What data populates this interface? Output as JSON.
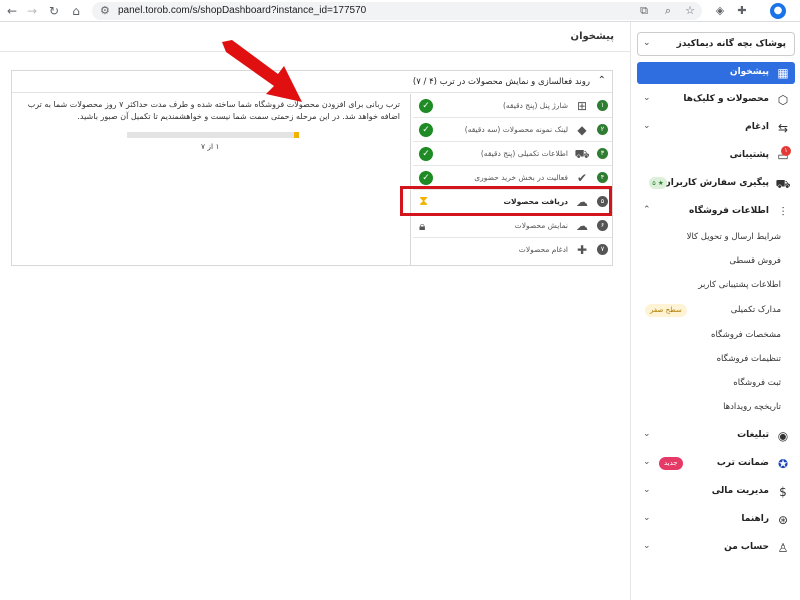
{
  "browser": {
    "url": "panel.torob.com/s/shopDashboard?instance_id=177570"
  },
  "header": {
    "title": "پیشخوان"
  },
  "sidebar": {
    "shop_name": "پوشاک بچه گانه دیماکیدز",
    "items": [
      {
        "label": "پیشخوان",
        "icon": "dashboard-icon",
        "active": true
      },
      {
        "label": "محصولات و کلیک‌ها",
        "icon": "box-icon"
      },
      {
        "label": "ادغام",
        "icon": "merge-icon"
      },
      {
        "label": "پشتیبانی",
        "icon": "chat-icon",
        "badge": "۱"
      },
      {
        "label": "پیگیری سفارش کاربران",
        "icon": "truck-icon",
        "badge": "۵ ★"
      },
      {
        "label": "اطلاعات فروشگاه",
        "icon": "sliders-icon"
      }
    ],
    "sub_items": [
      {
        "label": "شرایط ارسال و تحویل کالا"
      },
      {
        "label": "فروش قسطی"
      },
      {
        "label": "اطلاعات پشتیبانی کاربر"
      },
      {
        "label": "مدارک تکمیلی",
        "badge": "سطح صفر"
      },
      {
        "label": "مشخصات فروشگاه"
      },
      {
        "label": "تنظیمات فروشگاه"
      },
      {
        "label": "ثبت فروشگاه"
      },
      {
        "label": "تاریخچه رویدادها"
      }
    ],
    "bottom_items": [
      {
        "label": "تبلیغات",
        "icon": "broadcast-icon"
      },
      {
        "label": "ضمانت ترب",
        "icon": "shield-icon",
        "badge": "جدید"
      },
      {
        "label": "مدیریت مالی",
        "icon": "dollar-icon"
      },
      {
        "label": "راهنما",
        "icon": "help-icon"
      },
      {
        "label": "حساب من",
        "icon": "user-icon"
      }
    ]
  },
  "panel": {
    "title": "روند فعالسازی و نمایش محصولات در ترب (۴ / ۷)",
    "steps": [
      {
        "num": "۱",
        "label": "شارژ پنل (پنج دقیقه)",
        "icon": "plus-box-icon",
        "status": "done"
      },
      {
        "num": "۲",
        "label": "لینک نمونه محصولات (سه دقیقه)",
        "icon": "tag-icon",
        "status": "done"
      },
      {
        "num": "۳",
        "label": "اطلاعات تکمیلی (پنج دقیقه)",
        "icon": "cart-icon",
        "status": "done"
      },
      {
        "num": "۴",
        "label": "فعالیت در بخش خرید حضوری",
        "icon": "check-icon",
        "status": "done"
      },
      {
        "num": "۵",
        "label": "دریافت محصولات",
        "icon": "cloud-download-icon",
        "status": "pending"
      },
      {
        "num": "۶",
        "label": "نمایش محصولات",
        "icon": "cloud-eye-icon",
        "status": "locked"
      },
      {
        "num": "۷",
        "label": "ادغام محصولات",
        "icon": "plus-icon",
        "status": "locked"
      }
    ],
    "detail": {
      "text": "ترب ربانی برای افزودن محصولات فروشگاه شما ساخته شده و طرف مدت حداکثر ۷ روز محصولات شما به ترب اضافه خواهد شد. در این مرحله زحمتی سمت شما نیست و خواهشمندیم تا تکمیل آن صبور باشید.",
      "progress_caption": "۱ از ۷",
      "progress_fraction": 0.03
    }
  },
  "colors": {
    "accent": "#2e6ee0",
    "success": "#1f8b24",
    "highlight": "#d4141c",
    "progress": "#f0b400"
  }
}
